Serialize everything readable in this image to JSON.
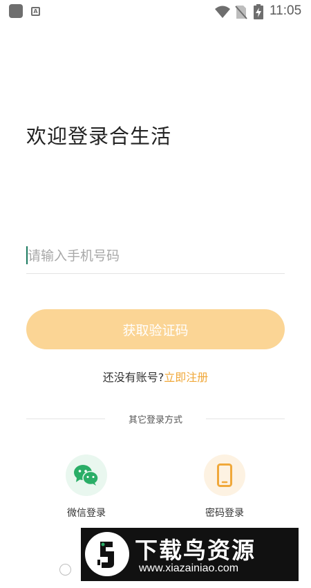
{
  "status_bar": {
    "a_badge": "A",
    "time": "11:05"
  },
  "login": {
    "title": "欢迎登录合生活",
    "phone_placeholder": "请输入手机号码",
    "get_code_label": "获取验证码",
    "no_account_text": "还没有账号?",
    "register_label": "立即注册",
    "other_methods_label": "其它登录方式",
    "options": [
      {
        "label": "微信登录",
        "icon": "wechat-icon"
      },
      {
        "label": "密码登录",
        "icon": "phone-icon"
      }
    ]
  },
  "watermark": {
    "title": "下载鸟资源",
    "url": "www.xiazainiao.com"
  },
  "colors": {
    "accent": "#f0a83a",
    "button_bg": "#fbd595",
    "wechat_green": "#2aae67",
    "caret": "#1a7a5f"
  }
}
